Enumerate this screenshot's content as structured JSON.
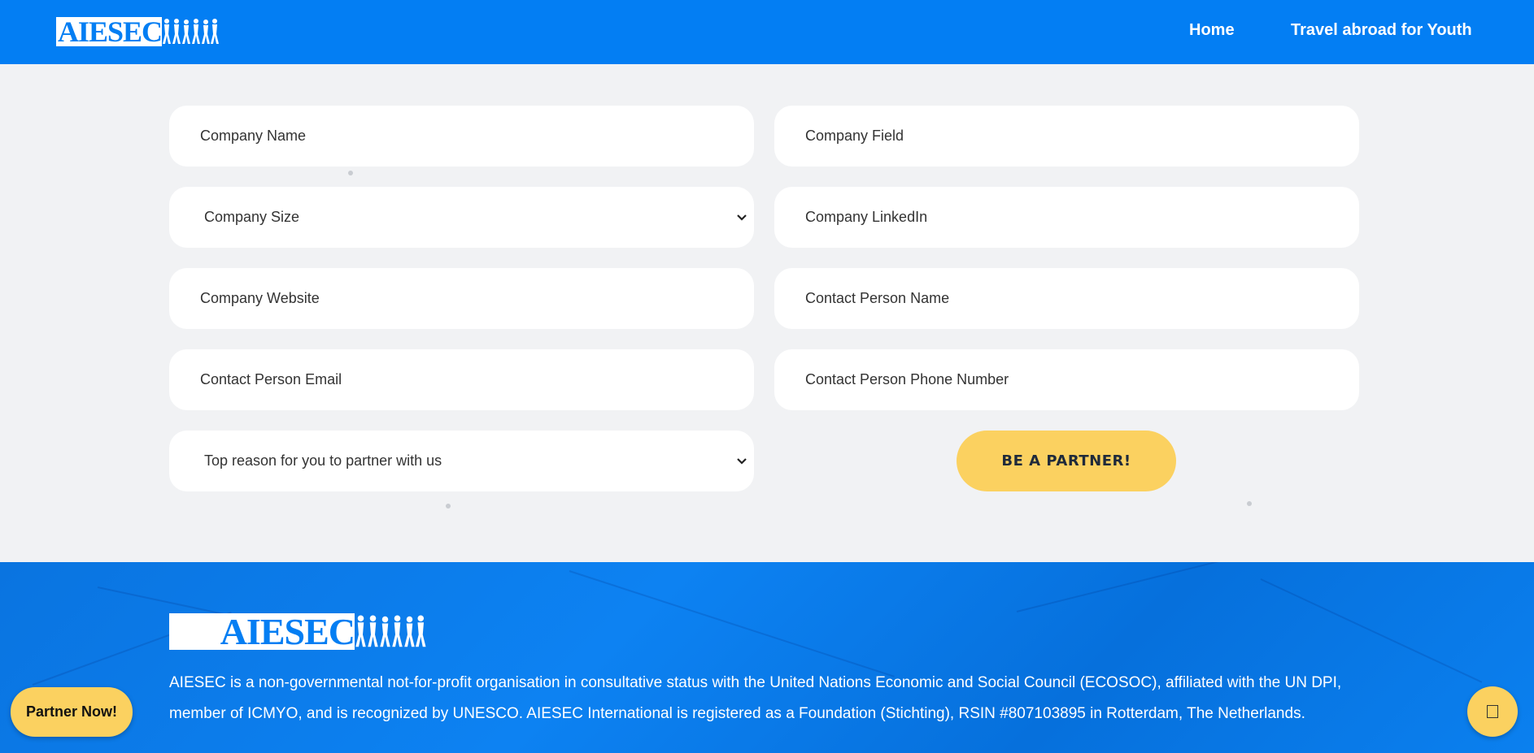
{
  "header": {
    "logo_text": "AIESEC",
    "nav": [
      {
        "label": "Home"
      },
      {
        "label": "Travel abroad for Youth"
      }
    ]
  },
  "form": {
    "fields": [
      {
        "placeholder": "Company Name",
        "type": "text"
      },
      {
        "placeholder": "Company Field",
        "type": "text"
      },
      {
        "placeholder": "Company Size",
        "type": "select"
      },
      {
        "placeholder": "Company LinkedIn",
        "type": "text"
      },
      {
        "placeholder": "Company Website",
        "type": "text"
      },
      {
        "placeholder": "Contact Person Name",
        "type": "text"
      },
      {
        "placeholder": "Contact Person Email",
        "type": "text"
      },
      {
        "placeholder": "Contact Person Phone Number",
        "type": "text"
      },
      {
        "placeholder": "Top reason for you to partner with us",
        "type": "select"
      }
    ],
    "submit_label": "BE A PARTNER!"
  },
  "footer": {
    "logo_text": "AIESEC",
    "description": "AIESEC is a non-governmental not-for-profit organisation in consultative status with the United Nations Economic and Social Council (ECOSOC), affiliated with the UN DPI, member of ICMYO, and is recognized by UNESCO. AIESEC International is registered as a Foundation (Stichting), RSIN #807103895 in Rotterdam, The Netherlands."
  },
  "floating": {
    "partner_label": "Partner Now!",
    "chat_icon": "chat-icon"
  },
  "colors": {
    "brand_blue": "#037ef3",
    "accent_yellow": "#fbd160",
    "page_bg": "#f1f2f4"
  }
}
